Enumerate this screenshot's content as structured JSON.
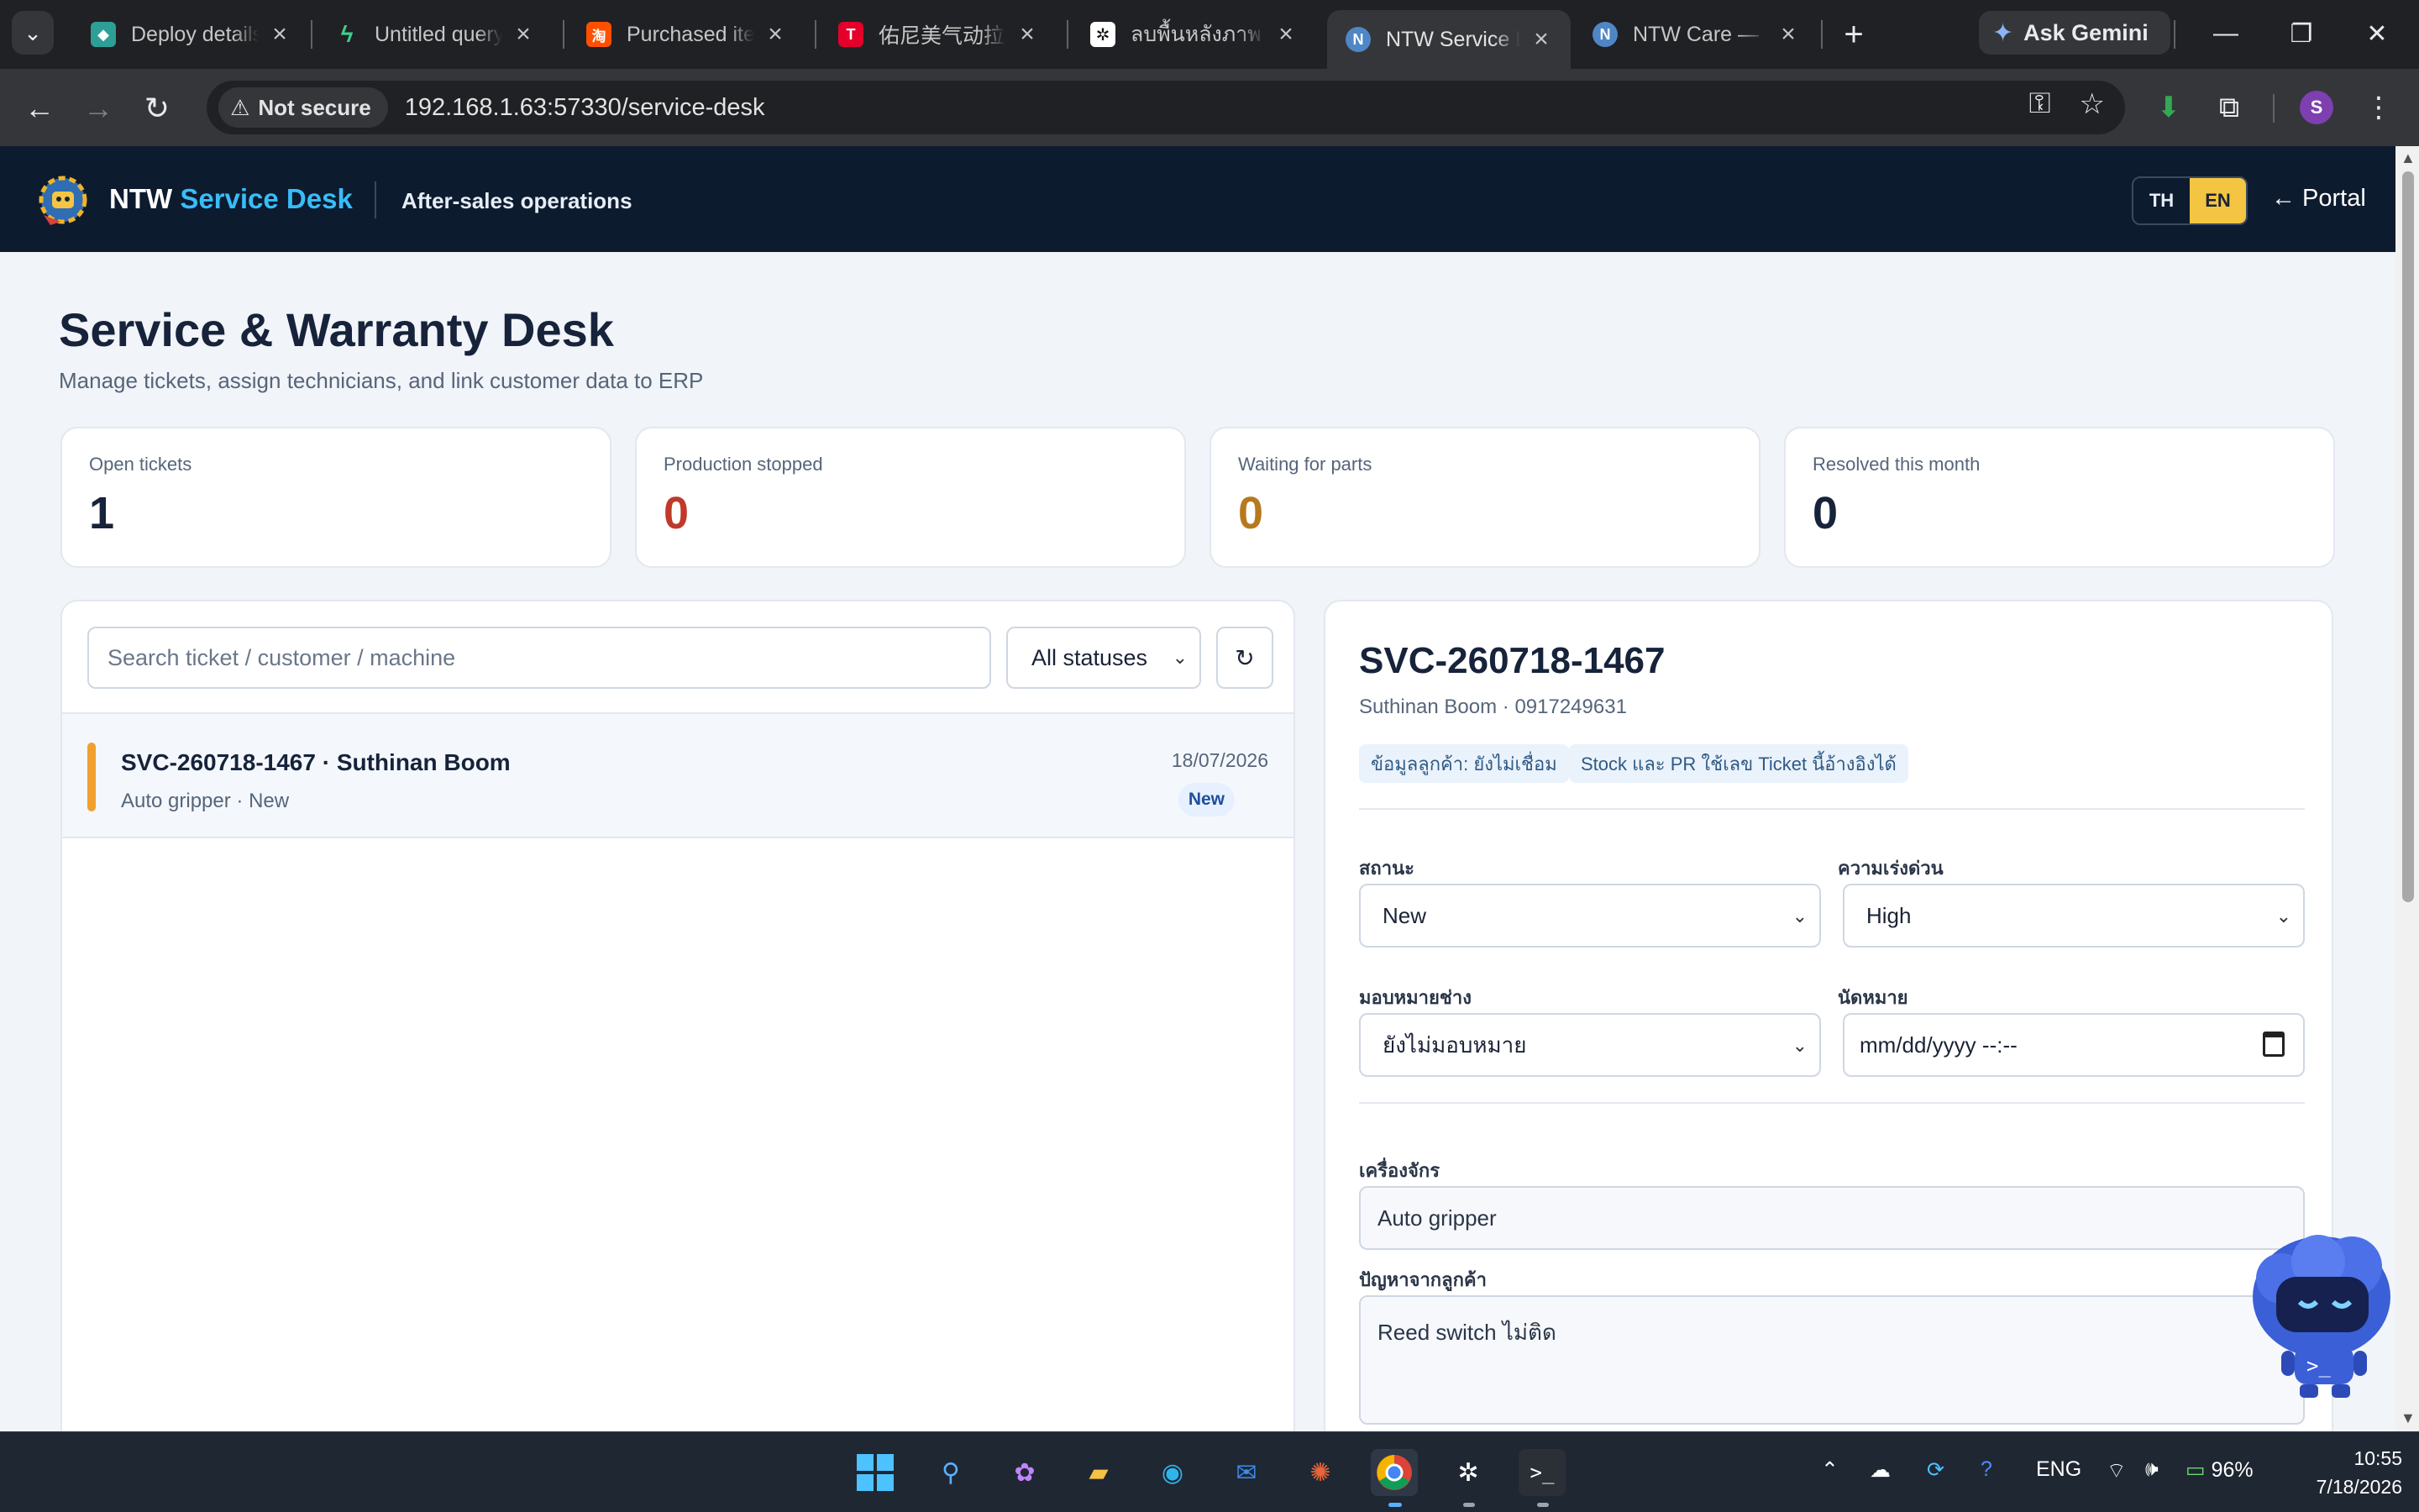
{
  "browser": {
    "tabs": [
      {
        "title": "Deploy details",
        "icon": "netlify-icon",
        "color": "#2e9f96"
      },
      {
        "title": "Untitled query",
        "icon": "supabase-icon",
        "color": "#3ecf8e"
      },
      {
        "title": "Purchased items",
        "icon": "taobao-icon",
        "color": "#ff5000"
      },
      {
        "title": "佑尼美气动拉线",
        "icon": "tmall-icon",
        "color": "#e4002b"
      },
      {
        "title": "ลบพื้นหลังภาพ",
        "icon": "chatgpt-icon",
        "color": "#ffffff"
      },
      {
        "title": "NTW Service Desk",
        "icon": "ntw-icon",
        "color": "#7aa7d8",
        "active": true
      },
      {
        "title": "NTW Care — Service",
        "icon": "ntw-icon",
        "color": "#7aa7d8"
      }
    ],
    "ask_gemini": "Ask Gemini",
    "security_label": "Not secure",
    "url": "192.168.1.63:57330/service-desk",
    "profile_initial": "S"
  },
  "header": {
    "brand_prefix": "NTW",
    "brand_accent": "Service Desk",
    "subtitle": "After-sales operations",
    "lang_th": "TH",
    "lang_en": "EN",
    "portal_link": "← Portal"
  },
  "page": {
    "title": "Service & Warranty Desk",
    "subtitle": "Manage tickets, assign technicians, and link customer data to ERP"
  },
  "stats": [
    {
      "label": "Open tickets",
      "value": "1",
      "color": "#16233a"
    },
    {
      "label": "Production stopped",
      "value": "0",
      "color": "#c0392b"
    },
    {
      "label": "Waiting for parts",
      "value": "0",
      "color": "#b7791f"
    },
    {
      "label": "Resolved this month",
      "value": "0",
      "color": "#16233a"
    }
  ],
  "list": {
    "search_placeholder": "Search ticket / customer / machine",
    "status_filter": "All statuses",
    "refresh_icon": "↻",
    "tickets": [
      {
        "title": "SVC-260718-1467 · Suthinan Boom",
        "sub": "Auto gripper · New",
        "date": "18/07/2026",
        "badge": "New"
      }
    ]
  },
  "detail": {
    "ticket_id": "SVC-260718-1467",
    "customer_line": "Suthinan Boom · 0917249631",
    "chips": [
      "ข้อมูลลูกค้า: ยังไม่เชื่อม",
      "Stock และ PR ใช้เลข Ticket นี้อ้างอิงได้"
    ],
    "status_label": "สถานะ",
    "status_value": "New",
    "urgency_label": "ความเร่งด่วน",
    "urgency_value": "High",
    "assign_label": "มอบหมายช่าง",
    "assign_value": "ยังไม่มอบหมาย",
    "appointment_label": "นัดหมาย",
    "appointment_placeholder": "mm/dd/yyyy --:--",
    "machine_label": "เครื่องจักร",
    "machine_value": "Auto gripper",
    "problem_label": "ปัญหาจากลูกค้า",
    "problem_value": "Reed switch ไม่ติด"
  },
  "taskbar": {
    "tray_lang": "ENG",
    "battery": "96%",
    "time": "10:55",
    "date": "7/18/2026"
  }
}
